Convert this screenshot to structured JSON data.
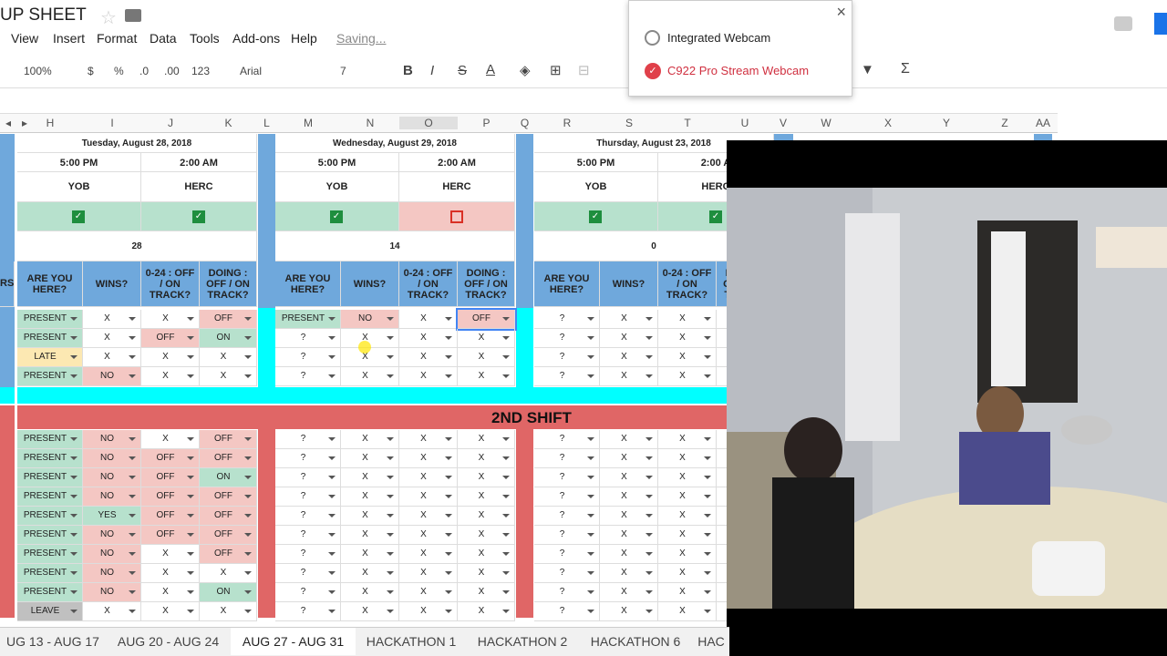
{
  "doc": {
    "title": "UP SHEET"
  },
  "menu": [
    "View",
    "Insert",
    "Format",
    "Data",
    "Tools",
    "Add-ons",
    "Help"
  ],
  "saving": "Saving...",
  "toolbar": {
    "zoom": "100%",
    "currency": "$",
    "percent": "%",
    "dec_down": ".0",
    "dec_up": ".00",
    "format": "123",
    "font": "Arial",
    "size": "7"
  },
  "columns": [
    "H",
    "I",
    "J",
    "K",
    "L",
    "M",
    "N",
    "O",
    "P",
    "Q",
    "R",
    "S",
    "T",
    "U",
    "V",
    "W",
    "X",
    "Y",
    "Z",
    "AA"
  ],
  "days": [
    {
      "date": "Tuesday, August 28, 2018",
      "t1": "5:00 PM",
      "t2": "2:00 AM",
      "p1": "YOB",
      "p2": "HERC",
      "count": "28"
    },
    {
      "date": "Wednesday, August 29, 2018",
      "t1": "5:00 PM",
      "t2": "2:00 AM",
      "p1": "YOB",
      "p2": "HERC",
      "count": "14"
    },
    {
      "date": "Thursday, August 23, 2018",
      "t1": "5:00 PM",
      "t2": "2:00 A",
      "p1": "YOB",
      "p2": "HERC",
      "count": "0"
    }
  ],
  "headers": [
    "ARE YOU HERE?",
    "WINS?",
    "0-24 : OFF / ON TRACK?",
    "DOING : OFF / ON TRACK?"
  ],
  "row_label_edge": "RS",
  "rows1": [
    [
      [
        "PRESENT",
        "X",
        "X",
        "OFF"
      ],
      [
        "PRESENT",
        "NO",
        "X",
        "OFF"
      ],
      [
        "?",
        "X",
        "X",
        "X"
      ]
    ],
    [
      [
        "PRESENT",
        "X",
        "OFF",
        "ON"
      ],
      [
        "?",
        "X",
        "X",
        "X"
      ],
      [
        "?",
        "X",
        "X",
        "X"
      ]
    ],
    [
      [
        "LATE",
        "X",
        "X",
        "X"
      ],
      [
        "?",
        "X",
        "X",
        "X"
      ],
      [
        "?",
        "X",
        "X",
        "X"
      ]
    ],
    [
      [
        "PRESENT",
        "NO",
        "X",
        "X"
      ],
      [
        "?",
        "X",
        "X",
        "X"
      ],
      [
        "?",
        "X",
        "X",
        "X"
      ]
    ]
  ],
  "shift2": "2ND SHIFT",
  "rows2": [
    [
      "PRESENT",
      "NO",
      "X",
      "OFF"
    ],
    [
      "PRESENT",
      "NO",
      "OFF",
      "OFF"
    ],
    [
      "PRESENT",
      "NO",
      "OFF",
      "ON"
    ],
    [
      "PRESENT",
      "NO",
      "OFF",
      "OFF"
    ],
    [
      "PRESENT",
      "YES",
      "OFF",
      "OFF"
    ],
    [
      "PRESENT",
      "NO",
      "OFF",
      "OFF"
    ],
    [
      "PRESENT",
      "NO",
      "X",
      "OFF"
    ],
    [
      "PRESENT",
      "NO",
      "X",
      "X"
    ],
    [
      "PRESENT",
      "NO",
      "X",
      "ON"
    ],
    [
      "LEAVE",
      "X",
      "X",
      "X"
    ]
  ],
  "rows2_other": [
    "?",
    "X",
    "X",
    "X"
  ],
  "popup": {
    "opt1": "Integrated Webcam",
    "opt2": "C922 Pro Stream Webcam"
  },
  "sheet_tabs": [
    "UG 13 - AUG 17",
    "AUG 20 - AUG 24",
    "AUG 27 - AUG 31",
    "HACKATHON 1",
    "HACKATHON 2",
    "HACKATHON 6",
    "HAC"
  ],
  "colors": {
    "green": "#b7e1cd",
    "red": "#f4c7c3",
    "yellow": "#fce8b2",
    "cyan": "#00ffff",
    "shift": "#e06666",
    "sep": "#6fa8dc"
  }
}
